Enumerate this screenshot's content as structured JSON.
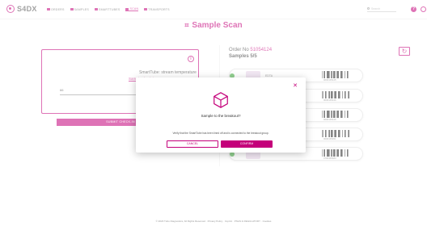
{
  "app": {
    "name": "S4DX",
    "accent": "#c4007a",
    "success": "#3aaa35"
  },
  "nav": {
    "items": [
      {
        "label": "Orders",
        "icon": "orders-icon"
      },
      {
        "label": "Samples",
        "icon": "samples-icon"
      },
      {
        "label": "SmartTubes",
        "icon": "smarttubes-icon"
      },
      {
        "label": "Scan",
        "icon": "scan-icon",
        "active": true
      },
      {
        "label": "Transports",
        "icon": "transports-icon"
      }
    ],
    "search_placeholder": "Search"
  },
  "page": {
    "title": "Sample Scan"
  },
  "card": {
    "title": "SmartTube:   stream temperature",
    "link": "Sample check-ins",
    "input_value": "66",
    "confirm_label": "CONFIRM",
    "submit_label": "SUBMIT CHECK-IN"
  },
  "order": {
    "label": "Order No",
    "number": "51054124",
    "samples": "Samples 5/5"
  },
  "samples": [
    {
      "name": "EDTA",
      "barcode": "0000105125"
    },
    {
      "name": "",
      "barcode": "0000105126"
    },
    {
      "name": "",
      "barcode": "0000105126"
    },
    {
      "name": "",
      "barcode": "0000105451"
    },
    {
      "name": "",
      "barcode": "0700305484"
    }
  ],
  "modal": {
    "title": "Sample to the breakout?",
    "description": "Verify that the SmartTube has been lined off and is connected to the breakout group.",
    "cancel_label": "CANCEL",
    "confirm_label": "CONFIRM"
  },
  "footer": {
    "text": "© 2023 Tubo Diagnostics, All Rights Reserved · Privacy Policy · Imprint · PNAS & REGULATORY · Cookies"
  }
}
